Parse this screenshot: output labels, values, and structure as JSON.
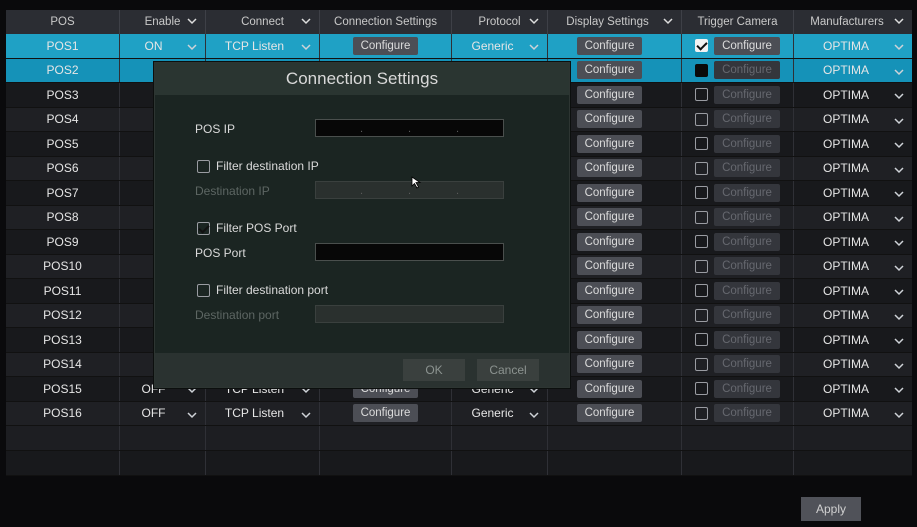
{
  "headers": [
    "POS",
    "Enable",
    "Connect",
    "Connection Settings",
    "Protocol",
    "Display Settings",
    "Trigger Camera",
    "Manufacturers"
  ],
  "rows": [
    {
      "name": "POS1",
      "enable": "ON",
      "connect": "TCP Listen",
      "conf": "Configure",
      "protocol": "Generic",
      "display": "Configure",
      "trigger": "Configure",
      "manu": "OPTIMA"
    },
    {
      "name": "POS2",
      "enable": "",
      "connect": "",
      "conf": "",
      "protocol": "",
      "display": "Configure",
      "trigger": "Configure",
      "manu": "OPTIMA"
    },
    {
      "name": "POS3",
      "display": "Configure",
      "trigger": "Configure",
      "manu": "OPTIMA"
    },
    {
      "name": "POS4",
      "display": "Configure",
      "trigger": "Configure",
      "manu": "OPTIMA"
    },
    {
      "name": "POS5",
      "display": "Configure",
      "trigger": "Configure",
      "manu": "OPTIMA"
    },
    {
      "name": "POS6",
      "display": "Configure",
      "trigger": "Configure",
      "manu": "OPTIMA"
    },
    {
      "name": "POS7",
      "display": "Configure",
      "trigger": "Configure",
      "manu": "OPTIMA"
    },
    {
      "name": "POS8",
      "display": "Configure",
      "trigger": "Configure",
      "manu": "OPTIMA"
    },
    {
      "name": "POS9",
      "display": "Configure",
      "trigger": "Configure",
      "manu": "OPTIMA"
    },
    {
      "name": "POS10",
      "display": "Configure",
      "trigger": "Configure",
      "manu": "OPTIMA"
    },
    {
      "name": "POS11",
      "display": "Configure",
      "trigger": "Configure",
      "manu": "OPTIMA"
    },
    {
      "name": "POS12",
      "display": "Configure",
      "trigger": "Configure",
      "manu": "OPTIMA"
    },
    {
      "name": "POS13",
      "display": "Configure",
      "trigger": "Configure",
      "manu": "OPTIMA"
    },
    {
      "name": "POS14",
      "display": "Configure",
      "trigger": "Configure",
      "manu": "OPTIMA"
    },
    {
      "name": "POS15",
      "enable": "OFF",
      "connect": "TCP Listen",
      "conf": "Configure",
      "protocol": "Generic",
      "display": "Configure",
      "trigger": "Configure",
      "manu": "OPTIMA"
    },
    {
      "name": "POS16",
      "enable": "OFF",
      "connect": "TCP Listen",
      "conf": "Configure",
      "protocol": "Generic",
      "display": "Configure",
      "trigger": "Configure",
      "manu": "OPTIMA"
    }
  ],
  "dialog": {
    "title": "Connection Settings",
    "pos_ip_label": "POS IP",
    "filter_dest_ip_label": "Filter destination IP",
    "dest_ip_label": "Destination IP",
    "filter_pos_port_label": "Filter POS Port",
    "pos_port_label": "POS Port",
    "filter_dest_port_label": "Filter destination port",
    "dest_port_label": "Destination port",
    "ok": "OK",
    "cancel": "Cancel"
  },
  "apply": "Apply"
}
